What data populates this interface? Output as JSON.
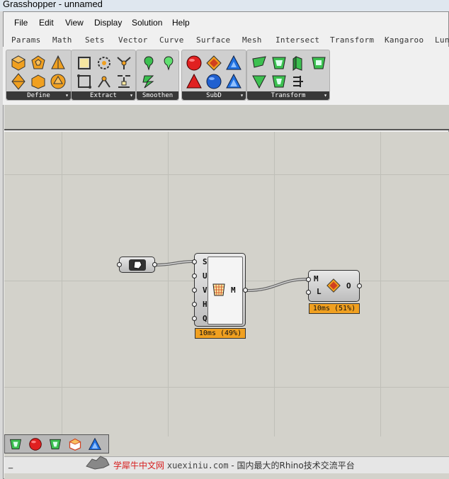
{
  "window": {
    "title": "Grasshopper - unnamed"
  },
  "menu": [
    "File",
    "Edit",
    "View",
    "Display",
    "Solution",
    "Help"
  ],
  "tabs": [
    "Params",
    "Math",
    "Sets",
    "Vector",
    "Curve",
    "Surface",
    "Mesh",
    "Intersect",
    "Transform",
    "Kangaroo",
    "Lun"
  ],
  "panels": {
    "define": "Define",
    "extract": "Extract",
    "smoothen": "Smoothen",
    "subd": "SubD",
    "transform": "Transform",
    "arrow": "▾"
  },
  "nodes": {
    "mesh_node": {
      "inputs": [
        "S",
        "U",
        "V",
        "H",
        "Q"
      ],
      "output": "M",
      "timing": "10ms (49%)"
    },
    "subd_node": {
      "inputs": [
        "M",
        "L"
      ],
      "output": "O",
      "timing": "10ms (51%)"
    }
  },
  "status": {
    "text": "_",
    "watermark_site": "学犀牛中文网",
    "watermark_url": "xuexiniu.com",
    "watermark_slogan": "- 国内最大的Rhino技术交流平台"
  },
  "colors": {
    "timing": "#f0a020",
    "canvas": "#d3d2cb",
    "panel_label": "#383838"
  }
}
